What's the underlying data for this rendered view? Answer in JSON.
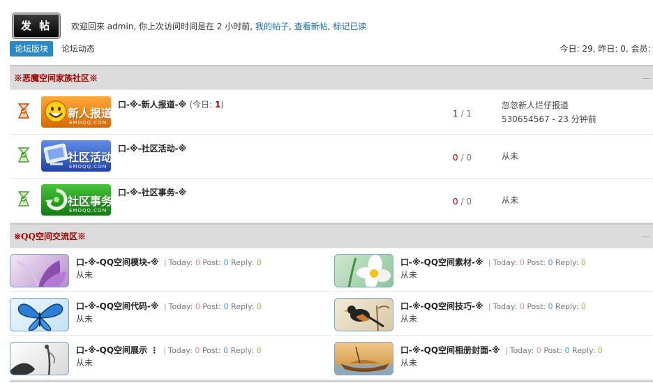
{
  "toolbar": {
    "post_button": "发 帖",
    "welcome_prefix": "欢迎回来  admin, 你上次访问时间是在  2 小时前,",
    "links": [
      "我的帖子",
      "查看新帖",
      "标记已读"
    ],
    "sep": ",",
    "tabs": [
      "论坛版块",
      "论坛动态"
    ],
    "stats": "今日: 29, 昨日: 0, 会员: 6"
  },
  "categories": [
    {
      "title": "※恶魔空间家族社区※",
      "forums": [
        {
          "logo_text": "新人报道",
          "logo_sub": "EMOQQ.COM",
          "name": "口-※-新人报道-※",
          "today_label": "(今日: ",
          "today_value": "1",
          "today_close": ")",
          "topics": "1",
          "posts": "1",
          "last_title": "忽忽新人烂仔报道",
          "last_meta": "530654567 - 23 分钟前",
          "status": "new",
          "color": "#e8800f"
        },
        {
          "logo_text": "社区活动",
          "logo_sub": "EMOQQ.COM",
          "name": "口-※-社区活动-※",
          "topics": "0",
          "posts": "0",
          "last_title": "从未",
          "status": "old",
          "color": "#3561c4"
        },
        {
          "logo_text": "社区事务",
          "logo_sub": "EMOQQ.COM",
          "name": "口-※-社区事务-※",
          "topics": "0",
          "posts": "0",
          "last_title": "从未",
          "status": "old",
          "color": "#2f9a2a"
        }
      ]
    },
    {
      "title": "※QQ空间交流区※",
      "forums": [
        {
          "name": "口-※-QQ空间模块-※",
          "today": "0",
          "post": "0",
          "reply": "0",
          "last": "从未",
          "thumb": "purple-flower"
        },
        {
          "name": "口-※-QQ空间素材-※",
          "today": "0",
          "post": "0",
          "reply": "0",
          "last": "从未",
          "thumb": "white-flower"
        },
        {
          "name": "口-※-QQ空间代码-※",
          "today": "0",
          "post": "0",
          "reply": "0",
          "last": "从未",
          "thumb": "butterfly"
        },
        {
          "name": "口-※-QQ空间技巧-※",
          "today": "0",
          "post": "0",
          "reply": "0",
          "last": "从未",
          "thumb": "bird"
        },
        {
          "name": "口-※-QQ空间展示 ⋮",
          "today": "0",
          "post": "0",
          "reply": "0",
          "last": "从未",
          "thumb": "figure"
        },
        {
          "name": "口-※-QQ空间相册封面-※",
          "today": "0",
          "post": "0",
          "reply": "0",
          "last": "从未",
          "thumb": "boat"
        }
      ]
    }
  ],
  "labels": {
    "today": "Today:",
    "post": "Post:",
    "reply": "Reply:",
    "pipe": "|",
    "slash": "/",
    "collapse": "—"
  }
}
